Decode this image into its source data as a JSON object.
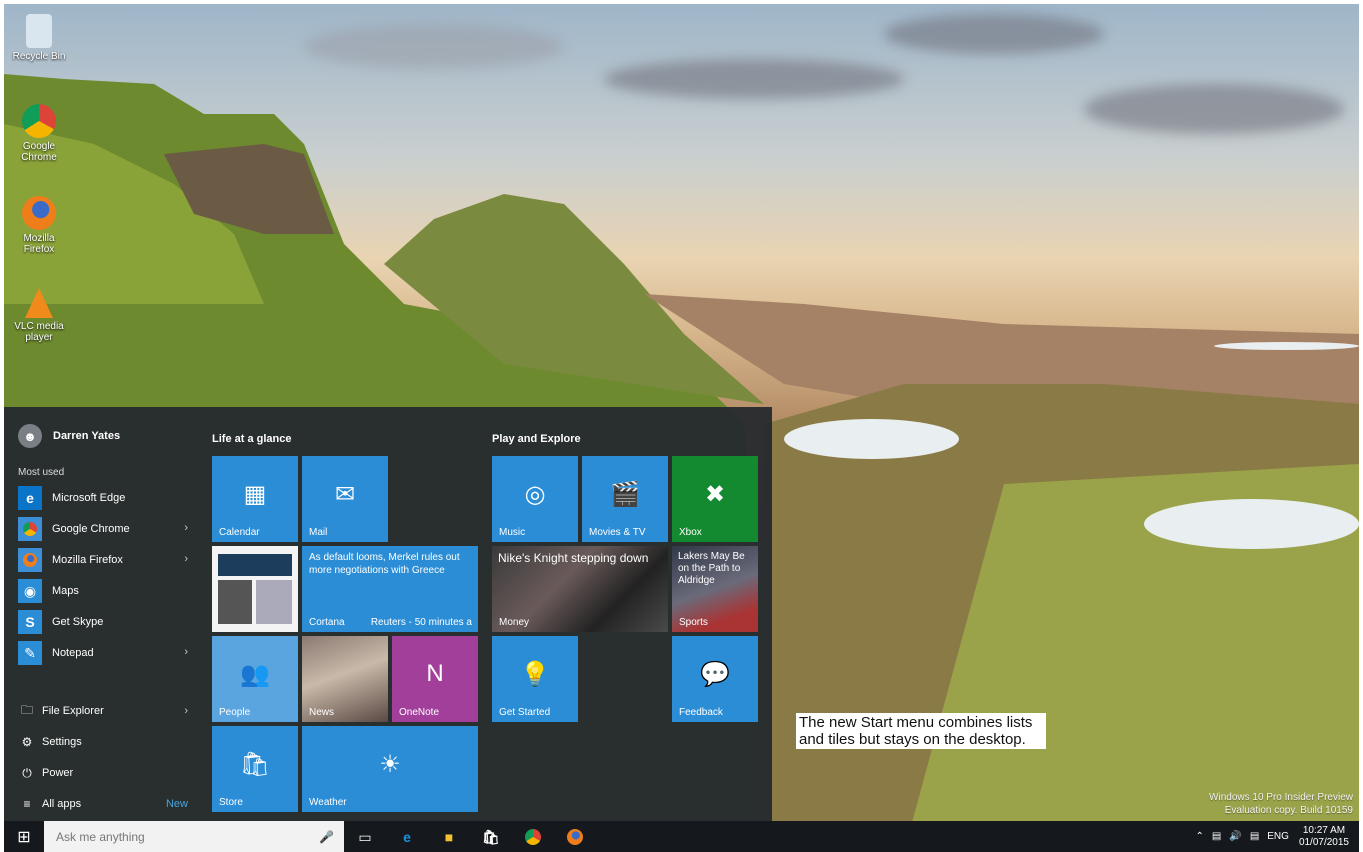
{
  "desktop": {
    "icons": [
      {
        "label": "Recycle Bin",
        "icon": "recycle-bin-icon"
      },
      {
        "label": "Google Chrome",
        "icon": "chrome-icon"
      },
      {
        "label": "Mozilla Firefox",
        "icon": "firefox-icon"
      },
      {
        "label": "VLC media player",
        "icon": "vlc-icon"
      }
    ],
    "watermark_line1": "Windows 10 Pro Insider Preview",
    "watermark_line2": "Evaluation copy. Build 10159"
  },
  "start_menu": {
    "user_name": "Darren Yates",
    "most_used_label": "Most used",
    "apps": [
      {
        "label": "Microsoft Edge",
        "icon": "edge-icon",
        "color": "#0a74c9",
        "has_chevron": false
      },
      {
        "label": "Google Chrome",
        "icon": "chrome-icon",
        "color": "#3c8fd6",
        "has_chevron": true
      },
      {
        "label": "Mozilla Firefox",
        "icon": "firefox-icon",
        "color": "#3c8fd6",
        "has_chevron": true
      },
      {
        "label": "Maps",
        "icon": "maps-icon",
        "color": "#2b8dd6",
        "has_chevron": false
      },
      {
        "label": "Get Skype",
        "icon": "skype-icon",
        "color": "#2b8dd6",
        "has_chevron": false
      },
      {
        "label": "Notepad",
        "icon": "notepad-icon",
        "color": "#2b8dd6",
        "has_chevron": true
      }
    ],
    "file_explorer": "File Explorer",
    "settings": "Settings",
    "power": "Power",
    "all_apps": "All apps",
    "all_apps_badge": "New",
    "groups": {
      "life": "Life at a glance",
      "play": "Play and Explore"
    },
    "tiles": {
      "calendar": "Calendar",
      "mail": "Mail",
      "cortana": "Cortana",
      "news_headline": "As default looms, Merkel rules out more negotiations with Greece",
      "news_source": "Reuters - 50 minutes a",
      "people": "People",
      "news": "News",
      "onenote": "OneNote",
      "store": "Store",
      "weather": "Weather",
      "music": "Music",
      "movies": "Movies & TV",
      "xbox": "Xbox",
      "money_headline": "Nike's Knight stepping down",
      "money": "Money",
      "sports_headline": "Lakers May Be on the Path to Aldridge",
      "sports": "Sports",
      "get_started": "Get Started",
      "feedback": "Feedback"
    }
  },
  "taskbar": {
    "search_placeholder": "Ask me anything",
    "lang": "ENG",
    "time": "10:27 AM",
    "date": "01/07/2015"
  },
  "caption": "The new Start menu combines lists and tiles but stays on the desktop."
}
